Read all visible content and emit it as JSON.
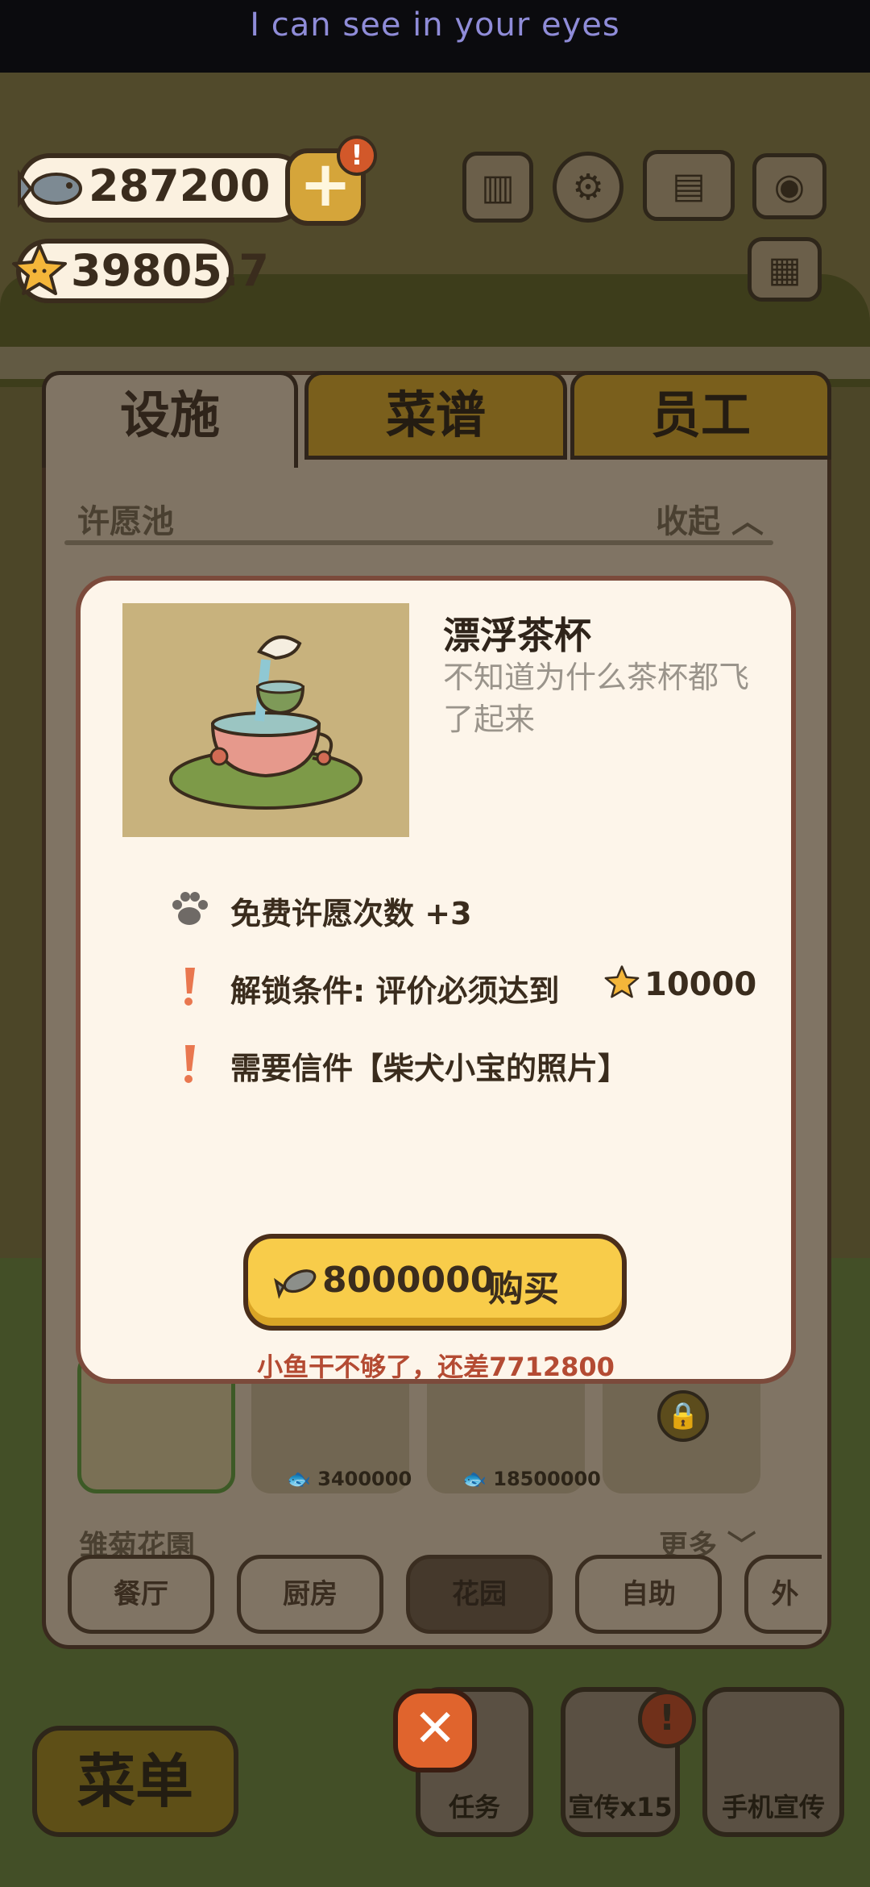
{
  "caption": {
    "text": "I can see in your eyes"
  },
  "currencies": {
    "fish": "287200",
    "stars": "39805.7"
  },
  "header": {
    "alert_badge": "!"
  },
  "tabs": [
    {
      "label": "设施",
      "active": true
    },
    {
      "label": "菜谱",
      "active": false
    },
    {
      "label": "员工",
      "active": false
    }
  ],
  "section_wish": {
    "title": "许愿池",
    "action": "收起"
  },
  "section_garden": {
    "title": "雏菊花園",
    "action": "更多"
  },
  "items": [
    {
      "price": "3400000"
    },
    {
      "price": "18500000"
    }
  ],
  "categories": [
    {
      "label": "餐厅",
      "active": false
    },
    {
      "label": "厨房",
      "active": false
    },
    {
      "label": "花园",
      "active": true
    },
    {
      "label": "自助",
      "active": false
    },
    {
      "label": "外",
      "active": false
    }
  ],
  "bottom_bar": {
    "menu_label": "菜单",
    "task_label": "任务",
    "promo_label": "宣传x15",
    "phone_label": "手机宣传",
    "promo_badge": "!"
  },
  "modal": {
    "title": "漂浮茶杯",
    "description": "不知道为什么茶杯都飞了起来",
    "bonus": "免费许愿次数 +3",
    "unlock_condition": "解锁条件: 评价必须达到",
    "unlock_value": "10000",
    "requirement": "需要信件【柴犬小宝的照片】",
    "buy_price": "8000000",
    "buy_label": "购买",
    "shortfall": "小鱼干不够了，还差7712800"
  },
  "icons": [
    "fish-icon",
    "star-icon",
    "plus-icon",
    "rank-icon",
    "gear-icon",
    "book-icon",
    "camera-icon",
    "letter-icon",
    "paw-icon",
    "exclamation-icon",
    "lock-icon",
    "close-icon",
    "chevron-up-icon",
    "chevron-down-icon"
  ],
  "colors": {
    "accent_yellow": "#f8cc4a",
    "warning_red": "#b44b33",
    "exclamation": "#e9774f",
    "modal_bg": "#fdf5ea"
  }
}
